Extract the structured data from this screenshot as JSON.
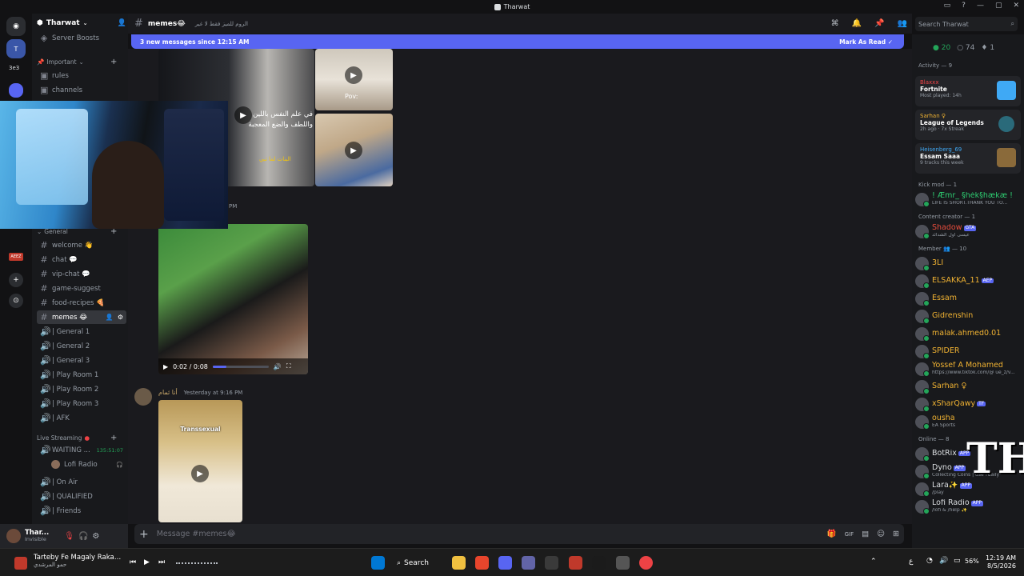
{
  "window": {
    "title": "Tharwat"
  },
  "server": {
    "name": "Tharwat",
    "boosts_label": "Server Boosts"
  },
  "rail": {
    "label_3e3": "3e3"
  },
  "categories": {
    "important": "Important",
    "general": "General",
    "live": "Live Streaming"
  },
  "channels": {
    "important": [
      {
        "label": "rules"
      },
      {
        "label": "channels"
      }
    ],
    "text": [
      {
        "label": "welcome 👋"
      },
      {
        "label": "chat 💬"
      },
      {
        "label": "vip-chat 💬"
      },
      {
        "label": "game-suggest"
      },
      {
        "label": "food-recipes 🍕"
      },
      {
        "label": "memes 😂"
      }
    ],
    "voice": [
      {
        "label": "| General 1"
      },
      {
        "label": "| General 2"
      },
      {
        "label": "| General 3"
      },
      {
        "label": "| Play Room 1"
      },
      {
        "label": "| Play Room 2"
      },
      {
        "label": "| Play Room 3"
      },
      {
        "label": "| AFK"
      }
    ],
    "live": [
      {
        "label": "WAITING ..."
      },
      {
        "label": "| On Air"
      },
      {
        "label": "| QUALIFIED"
      },
      {
        "label": "| Friends"
      }
    ],
    "live_timer": "135:51:07",
    "live_sub": "Lofi Radio"
  },
  "user": {
    "name": "Thar...",
    "status": "Invisible"
  },
  "header": {
    "channel": "memes😂",
    "topic": "الروم للميز فقط لا غير"
  },
  "search": {
    "placeholder": "Search Tharwat"
  },
  "banner": {
    "text": "3 new messages since 12:15 AM",
    "action": "Mark As Read"
  },
  "messages": {
    "time1": "PM",
    "video": {
      "time": "0:02 / 0:08",
      "progress": 0.25
    },
    "author": "أنا ثمام",
    "timestamp": "Yesterday at 9:16 PM",
    "thumb_text": "Transsexual",
    "media_text_1": "في علم النفس باللين واللطف والضع المعجبة",
    "media_text_2": "البنات لما تبي",
    "media_text_3": "Pov:"
  },
  "composer": {
    "placeholder": "Message #memes😂"
  },
  "stats": {
    "online": "20",
    "idle": "74",
    "other": "1"
  },
  "activity": {
    "title": "Activity — 9",
    "items": [
      {
        "user": "Blaxxx",
        "game": "Fortnite",
        "detail": "Most played: 14h"
      },
      {
        "user": "Sarhan ♀",
        "game": "League of Legends",
        "detail": "2h ago · 7x Streak"
      },
      {
        "user": "Heisenberg_69",
        "game": "Essam Saaa",
        "detail": "9 tracks this week"
      }
    ]
  },
  "member_groups": [
    {
      "title": "Kick mod — 1",
      "members": [
        {
          "name": "! Æmr_ §hèk§hækæ !",
          "sub": "LIFE IS SHORT.THANK YOU TO...",
          "color": "#2ecc71"
        }
      ]
    },
    {
      "title": "Content creator — 1",
      "members": [
        {
          "name": "Shadow",
          "sub": "عيسى اول الشدائد",
          "color": "#e74c3c",
          "tag": "GTA"
        }
      ]
    },
    {
      "title": "Member 👥 — 10",
      "members": [
        {
          "name": "3LI",
          "color": "#f0b232"
        },
        {
          "name": "ELSAKKA_11",
          "color": "#f0b232",
          "tag": "AEP"
        },
        {
          "name": "Essam",
          "color": "#f0b232"
        },
        {
          "name": "Gidrenshin",
          "color": "#f0b232"
        },
        {
          "name": "malak.ahmed0.01",
          "color": "#f0b232"
        },
        {
          "name": "SPIDER",
          "color": "#f0b232"
        },
        {
          "name": "Yossef A Mohamed",
          "color": "#f0b232",
          "sub": "https://www.tiktok.com/@ ue_z/v..."
        },
        {
          "name": "Sarhan ♀",
          "color": "#f0b232"
        },
        {
          "name": "xSharQawy",
          "color": "#f0b232",
          "tag": "TF"
        },
        {
          "name": "ousha",
          "color": "#f0b232",
          "sub": "EA Sports"
        }
      ]
    },
    {
      "title": "Online — 8",
      "members": [
        {
          "name": "BotRix",
          "color": "#dbdee1",
          "tag": "APP"
        },
        {
          "name": "Dyno",
          "color": "#dbdee1",
          "tag": "APP",
          "sub": "Collecting Coins | use ?daily"
        },
        {
          "name": "Lara✨",
          "color": "#dbdee1",
          "tag": "APP",
          "sub": "/play"
        },
        {
          "name": "Lofi Radio",
          "color": "#dbdee1",
          "tag": "APP",
          "sub": "/lofi & /help ✨"
        }
      ]
    }
  ],
  "taskbar": {
    "song": "Tarteby Fe Magaly Rakam...",
    "artist": "حمو المرشدي",
    "search": "Search",
    "lang": "ع",
    "battery": "56%",
    "time": "12:19 AM",
    "date": "8/5/2026"
  },
  "colors": {
    "accent": "#5865f2",
    "online": "#23a559",
    "banner": "#5865f2"
  }
}
